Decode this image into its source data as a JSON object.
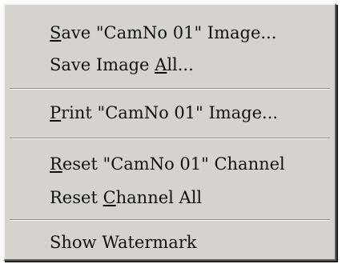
{
  "menu": {
    "items": [
      {
        "pre": "",
        "key": "S",
        "post": "ave \"CamNo 01\" Image..."
      },
      {
        "pre": "Save Image ",
        "key": "A",
        "post": "ll..."
      },
      {
        "pre": "",
        "key": "P",
        "post": "rint \"CamNo 01\" Image..."
      },
      {
        "pre": "",
        "key": "R",
        "post": "eset \"CamNo 01\" Channel"
      },
      {
        "pre": "Reset ",
        "key": "C",
        "post": "hannel All"
      },
      {
        "pre": "Show Watermark",
        "key": "",
        "post": ""
      }
    ]
  }
}
